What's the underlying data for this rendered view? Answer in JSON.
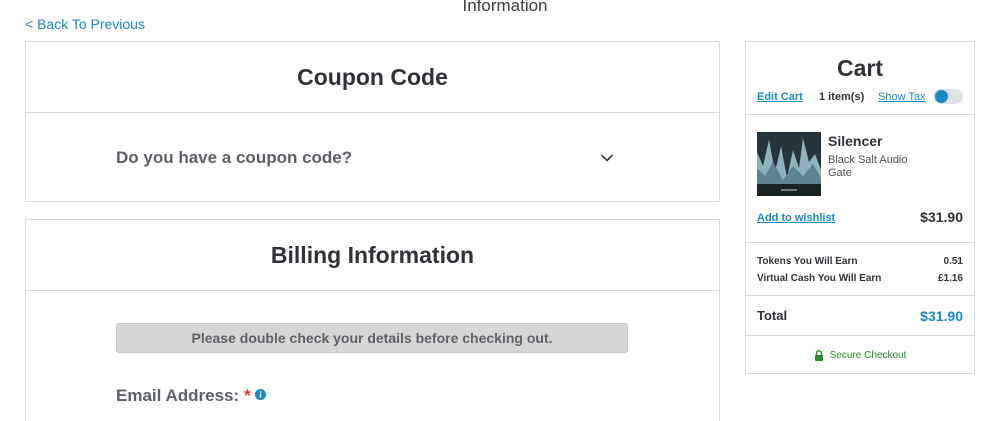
{
  "header": {
    "page_heading": "Information",
    "back_link": "< Back To Previous"
  },
  "coupon": {
    "title": "Coupon Code",
    "question": "Do you have a coupon code?",
    "expand_icon": "chevron-down-icon"
  },
  "billing": {
    "title": "Billing Information",
    "notice": "Please double check your details before checking out.",
    "email_label": "Email Address:",
    "required_mark": "*",
    "info_icon": "info-icon"
  },
  "cart": {
    "title": "Cart",
    "edit_cart": "Edit Cart",
    "item_count": "1 item(s)",
    "show_tax": "Show Tax",
    "show_tax_enabled": false,
    "items": [
      {
        "name": "Silencer",
        "vendor": "Black Salt Audio",
        "type": "Gate",
        "price": "$31.90",
        "wishlist_label": "Add to wishlist"
      }
    ],
    "tokens_label": "Tokens You Will Earn",
    "tokens_value": "0.51",
    "virtual_cash_label": "Virtual Cash You Will Earn",
    "virtual_cash_value": "£1.16",
    "total_label": "Total",
    "total_value": "$31.90",
    "secure_checkout": "Secure Checkout",
    "secure_icon": "lock-icon"
  },
  "colors": {
    "accent": "#1b8ac4",
    "secure": "#2c8c2c",
    "required": "#e03a3a",
    "border": "#d7d9dc",
    "notice_bg": "#d6d6d6"
  }
}
